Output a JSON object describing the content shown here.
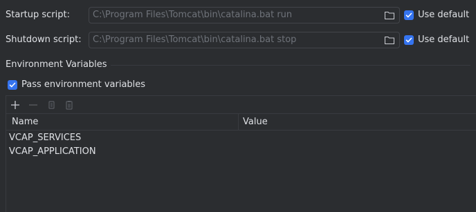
{
  "startup": {
    "label": "Startup script:",
    "path": "C:\\Program Files\\Tomcat\\bin\\catalina.bat run",
    "use_default_label": "Use default",
    "use_default_checked": true
  },
  "shutdown": {
    "label": "Shutdown script:",
    "path": "C:\\Program Files\\Tomcat\\bin\\catalina.bat stop",
    "use_default_label": "Use default",
    "use_default_checked": true
  },
  "env": {
    "section_title": "Environment Variables",
    "pass_label": "Pass environment variables",
    "pass_checked": true,
    "toolbar": [
      "add-icon",
      "remove-icon",
      "copy-icon",
      "paste-icon"
    ],
    "columns": {
      "name": "Name",
      "value": "Value"
    },
    "rows": [
      {
        "name": "VCAP_SERVICES",
        "value": ""
      },
      {
        "name": "VCAP_APPLICATION",
        "value": ""
      }
    ]
  },
  "colors": {
    "accent": "#3574f0",
    "background": "#2b2d30",
    "border": "#43454a"
  }
}
